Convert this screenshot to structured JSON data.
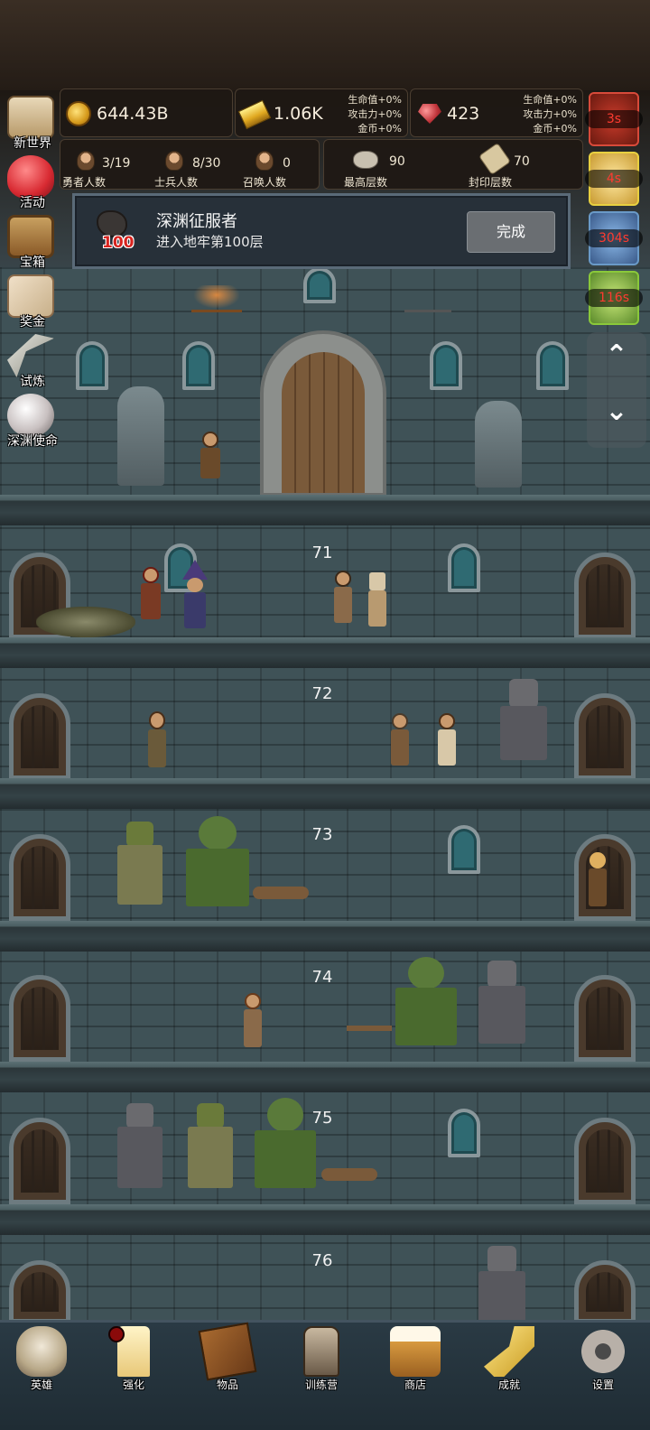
{
  "resources": {
    "coins": "644.43B",
    "gold": "1.06K",
    "gems": "423",
    "gold_bonus": [
      "生命值+0%",
      "攻击力+0%",
      "金币+0%"
    ],
    "gem_bonus": [
      "生命值+0%",
      "攻击力+0%",
      "金币+0%"
    ]
  },
  "counts": {
    "heroes": {
      "value": "3/19",
      "label": "勇者人数"
    },
    "soldiers": {
      "value": "8/30",
      "label": "士兵人数"
    },
    "summons": {
      "value": "0",
      "label": "召唤人数"
    },
    "max_floor": {
      "value": "90",
      "label": "最高层数"
    },
    "sealed_floor": {
      "value": "70",
      "label": "封印层数"
    }
  },
  "side_menu": [
    {
      "label": "新世界",
      "icon": "map-icon"
    },
    {
      "label": "活动",
      "icon": "heart-icon"
    },
    {
      "label": "宝箱",
      "icon": "chest-icon"
    },
    {
      "label": "奖金",
      "icon": "letter-icon"
    },
    {
      "label": "试炼",
      "icon": "scythe-icon"
    },
    {
      "label": "深渊使命",
      "icon": "orb-icon"
    }
  ],
  "buffs": [
    {
      "time": "3s",
      "icon": "potion-buff-icon"
    },
    {
      "time": "4s",
      "icon": "candle-buff-icon"
    },
    {
      "time": "304s",
      "icon": "crystal-buff-icon"
    },
    {
      "time": "116s",
      "icon": "coin-buff-icon"
    }
  ],
  "quest": {
    "title": "深渊征服者",
    "description": "进入地牢第100层",
    "badge": "100",
    "button": "完成"
  },
  "floors": [
    "71",
    "72",
    "73",
    "74",
    "75",
    "76"
  ],
  "bottom_nav": [
    {
      "label": "英雄",
      "icon": "skull-icon"
    },
    {
      "label": "强化",
      "icon": "candle-icon"
    },
    {
      "label": "物品",
      "icon": "book-icon"
    },
    {
      "label": "训练营",
      "icon": "lantern-icon"
    },
    {
      "label": "商店",
      "icon": "beer-mug-icon"
    },
    {
      "label": "成就",
      "icon": "key-icon"
    },
    {
      "label": "设置",
      "icon": "gear-icon"
    }
  ],
  "colors": {
    "timer_text": "#ff3b30",
    "hp_bar": "#e0301e",
    "quest_badge": "#d8231e"
  }
}
